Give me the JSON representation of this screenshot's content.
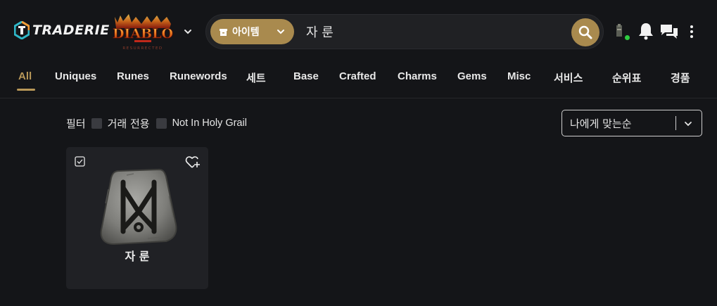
{
  "header": {
    "brand": "TRADERIE",
    "game_logo": "DIABLO II RESURRECTED",
    "search": {
      "category_label": "아이템",
      "value": "자 룬",
      "placeholder": ""
    }
  },
  "nav": {
    "items": [
      "All",
      "Uniques",
      "Runes",
      "Runewords",
      "세트",
      "Base",
      "Crafted",
      "Charms",
      "Gems",
      "Misc",
      "서비스",
      "순위표",
      "경품"
    ],
    "active": "All"
  },
  "filters": {
    "label": "필터",
    "options": [
      {
        "label": "거래 전용",
        "checked": false
      },
      {
        "label": "Not In Holy Grail",
        "checked": false
      }
    ]
  },
  "sort": {
    "selected": "나에게 맞는순"
  },
  "items": [
    {
      "name": "자 룬",
      "icon": "rune-icon"
    }
  ],
  "colors": {
    "accent": "#a98a4e",
    "background": "#141518",
    "card": "#202125",
    "online": "#2ecc40"
  }
}
